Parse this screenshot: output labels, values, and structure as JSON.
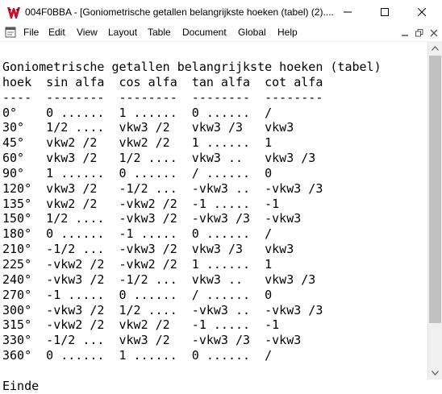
{
  "window": {
    "title": "004F0BBA - [Goniometrische getallen belangrijkste hoeken (tabel) (2)...."
  },
  "menu": {
    "items": [
      "File",
      "Edit",
      "View",
      "Layout",
      "Table",
      "Document",
      "Global",
      "Help"
    ]
  },
  "document": {
    "title_line": "Goniometrische getallen belangrijkste hoeken (tabel)",
    "header_line": "hoek  sin alfa  cos alfa  tan alfa  cot alfa",
    "separator_line": "----  --------  --------  --------  --------",
    "rows": [
      "0°    0 ......  1 ......  0 ......  /",
      "30°   1/2 ....  vkw3 /2   vkw3 /3   vkw3",
      "45°   vkw2 /2   vkw2 /2   1 ......  1",
      "60°   vkw3 /2   1/2 ....  vkw3 ..   vkw3 /3",
      "90°   1 ......  0 ......  / ......  0",
      "120°  vkw3 /2   -1/2 ...  -vkw3 ..  -vkw3 /3",
      "135°  vkw2 /2   -vkw2 /2  -1 .....  -1",
      "150°  1/2 ....  -vkw3 /2  -vkw3 /3  -vkw3",
      "180°  0 ......  -1 .....  0 ......  /",
      "210°  -1/2 ...  -vkw3 /2  vkw3 /3   vkw3",
      "225°  -vkw2 /2  -vkw2 /2  1 ......  1",
      "240°  -vkw3 /2  -1/2 ...  vkw3 ..   vkw3 /3",
      "270°  -1 .....  0 ......  / ......  0",
      "300°  -vkw3 /2  1/2 ....  -vkw3 ..  -vkw3 /3",
      "315°  -vkw2 /2  vkw2 /2   -1 .....  -1",
      "330°  -1/2 ...  vkw3 /2   -vkw3 /3  -vkw3",
      "360°  0 ......  1 ......  0 ......  /"
    ],
    "footer_line": "Einde"
  },
  "icons": {
    "app": "wordperfect-logo-icon",
    "minimize": "minimize-icon",
    "maximize": "maximize-icon",
    "close": "close-icon",
    "document": "document-icon",
    "mdi_minimize": "mdi-minimize-icon",
    "mdi_restore": "mdi-restore-icon",
    "mdi_close": "mdi-close-icon",
    "scroll_up": "scroll-up-arrow-icon",
    "scroll_down": "scroll-down-arrow-icon"
  },
  "colors": {
    "logo_red": "#c8102e",
    "scrollbar_track": "#f0f0f0",
    "scrollbar_thumb": "#c1c1c1"
  }
}
